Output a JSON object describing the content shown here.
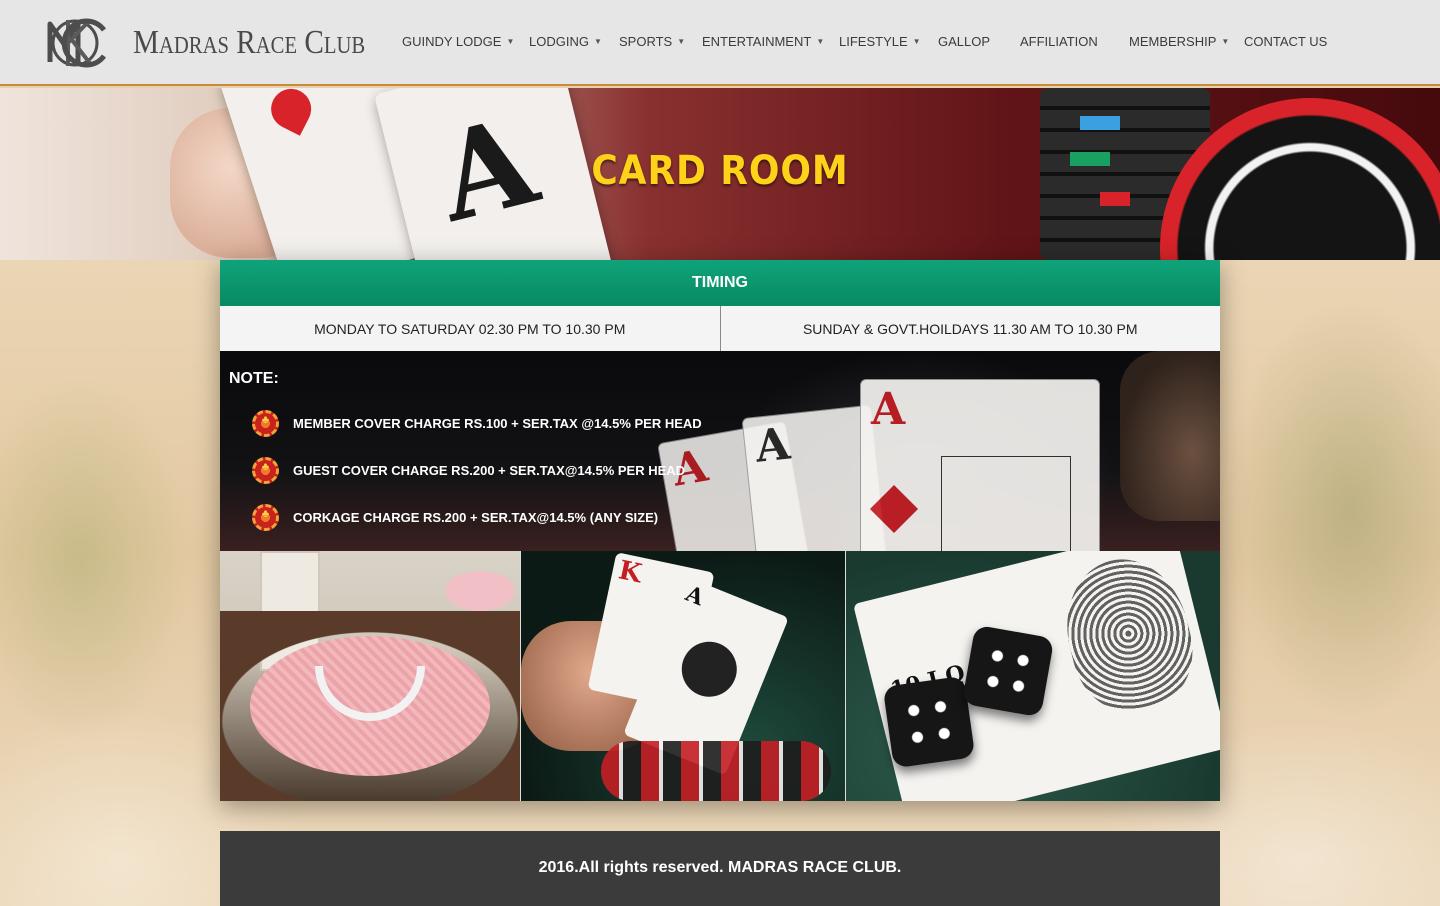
{
  "brand": {
    "name": "Madras Race Club"
  },
  "nav": {
    "items": [
      {
        "label": "GUINDY LODGE",
        "has_dropdown": true
      },
      {
        "label": "LODGING",
        "has_dropdown": true
      },
      {
        "label": "SPORTS",
        "has_dropdown": true
      },
      {
        "label": "ENTERTAINMENT",
        "has_dropdown": true
      },
      {
        "label": "LIFESTYLE",
        "has_dropdown": true
      },
      {
        "label": "GALLOP",
        "has_dropdown": false
      },
      {
        "label": "AFFILIATION",
        "has_dropdown": false
      },
      {
        "label": "MEMBERSHIP",
        "has_dropdown": true
      },
      {
        "label": "CONTACT US",
        "has_dropdown": false
      }
    ]
  },
  "hero": {
    "title": "CARD ROOM"
  },
  "timing": {
    "header": "TIMING",
    "weekday": "MONDAY TO SATURDAY 02.30 PM TO 10.30 PM",
    "weekend": "SUNDAY & GOVT.HOILDAYS 11.30 AM TO 10.30 PM"
  },
  "notes": {
    "title": "NOTE:",
    "items": [
      "MEMBER COVER CHARGE RS.100 + SER.TAX @14.5% PER HEAD",
      "GUEST COVER CHARGE RS.200 + SER.TAX@14.5% PER HEAD",
      "CORKAGE CHARGE RS.200 + SER.TAX@14.5% (ANY SIZE)"
    ]
  },
  "footer": {
    "copyright": "2016.All rights reserved. MADRAS RACE CLUB."
  },
  "colors": {
    "accent_green": "#0a9a70",
    "hero_title": "#ffd21a",
    "header_border": "#c98a3a",
    "footer_bg": "#3b3b3b"
  }
}
